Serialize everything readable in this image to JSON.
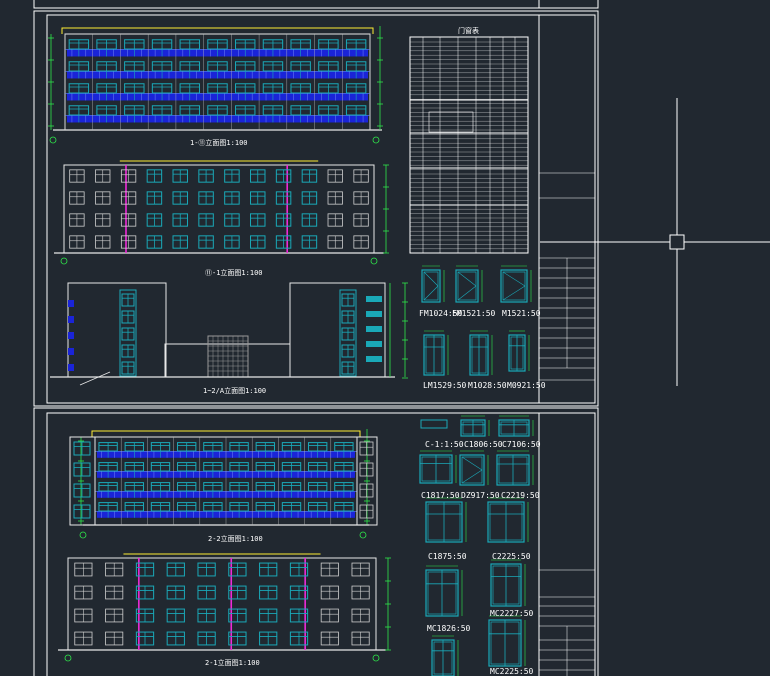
{
  "colors": {
    "background": "#212830",
    "frame": "#ffffff",
    "wall": "#e8e8e8",
    "glass": "#1aa9b8",
    "balcony": "#1a24d8",
    "dimension": "#2ee84a",
    "accent": "#ffee33",
    "pilaster": "#ee2ad8"
  },
  "sheet1": {
    "elev1_caption": "1-⑪立面图1:100",
    "elev2_caption": "⑪-1立面图1:100",
    "elev3_caption": "1~2/A立面图1:100",
    "door_table_title": "门窗表",
    "door_labels": [
      "FM1024:50",
      "FM1521:50",
      "M1521:50",
      "LM1529:50",
      "M1028:50",
      "M0921:50"
    ]
  },
  "sheet2": {
    "elev1_caption": "2-2立面图1:100",
    "elev2_caption": "2-1立面图1:100",
    "window_labels": [
      "C-1:1:50",
      "C1806:50",
      "C7106:50",
      "C1817:50",
      "DZ917:50",
      "C2219:50",
      "C1875:50",
      "C2225:50",
      "MC2227:50",
      "MC1826:50",
      "MC2225:50"
    ]
  }
}
